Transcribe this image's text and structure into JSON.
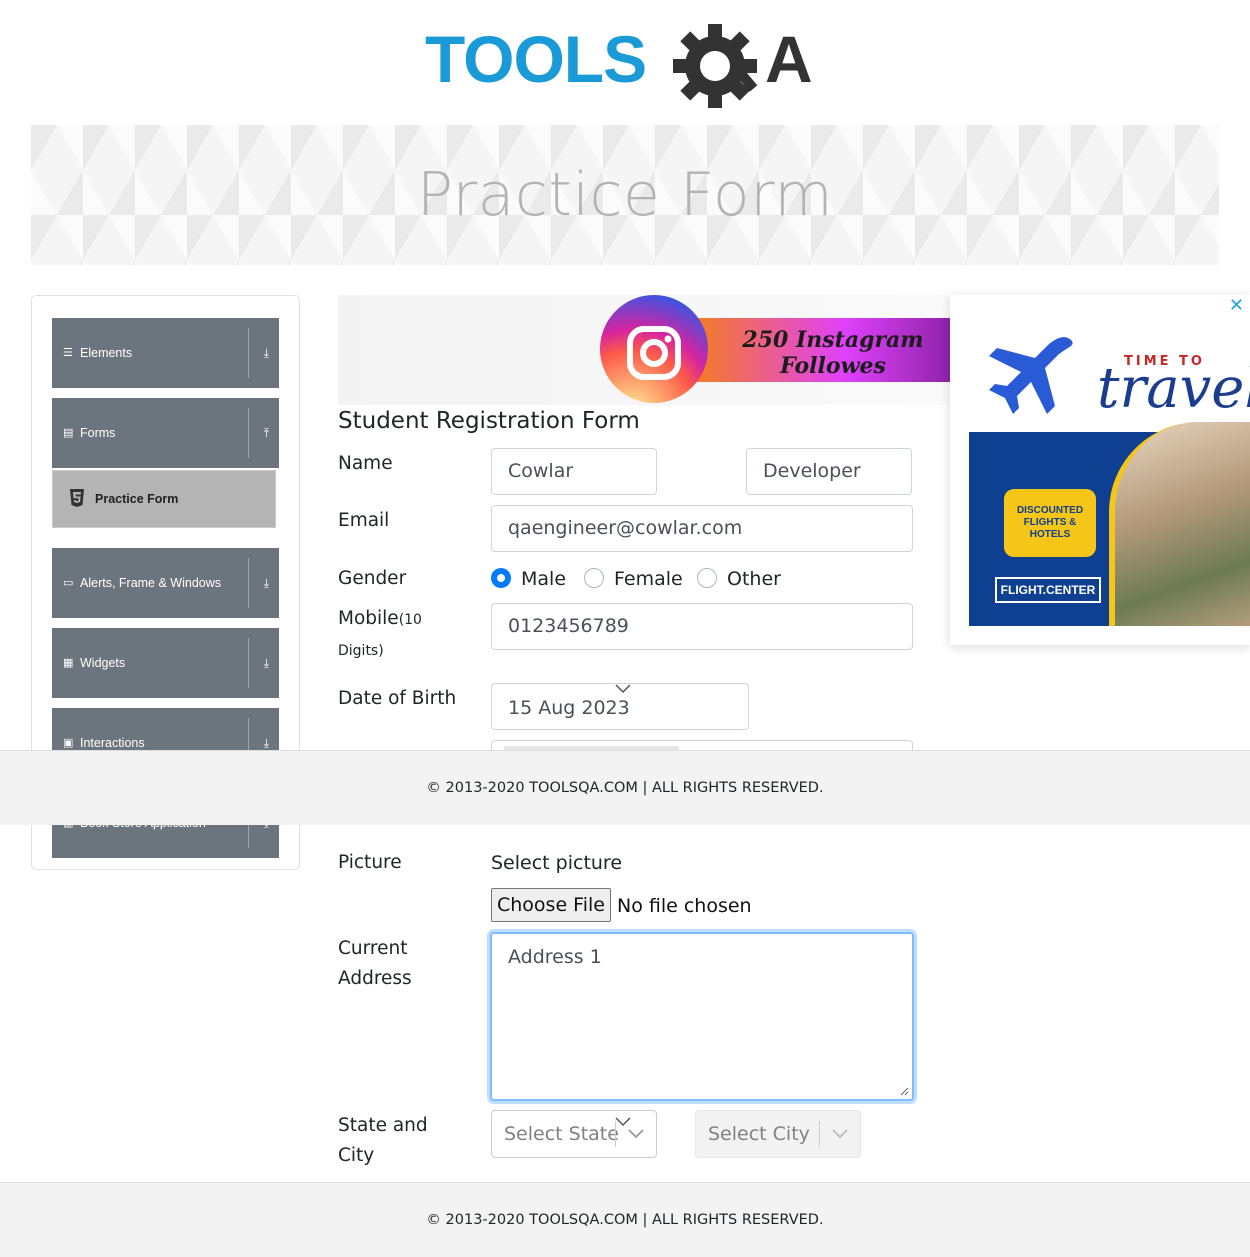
{
  "header": {
    "logo_text": "TOOLSQA",
    "logo_tools": "TOOLS",
    "logo_q": "Q",
    "logo_a": "A"
  },
  "banner": {
    "title": "Practice Form"
  },
  "sidebar": {
    "groups": [
      {
        "label": "Elements",
        "icon": "hamburger-icon",
        "arrow": "download-icon"
      },
      {
        "label": "Forms",
        "icon": "document-icon",
        "arrow": "upload-icon"
      },
      {
        "label": "Alerts, Frame & Windows",
        "icon": "window-icon",
        "arrow": "download-icon"
      },
      {
        "label": "Widgets",
        "icon": "grid-icon",
        "arrow": "download-icon"
      },
      {
        "label": "Interactions",
        "icon": "interactions-icon",
        "arrow": "download-icon"
      },
      {
        "label": "Book Store Application",
        "icon": "bar-chart-icon",
        "arrow": "download-icon"
      }
    ],
    "active_item": {
      "label": "Practice Form",
      "icon": "html5-icon"
    }
  },
  "ads": {
    "instagram": {
      "line1": "250 Instagram",
      "line2": "Followes"
    },
    "travel": {
      "time_to": "TIME TO",
      "travel": "travel",
      "bubble": "DISCOUNTED FLIGHTS & HOTELS",
      "brand": "FLIGHT.CENTER",
      "close": "✕"
    }
  },
  "form": {
    "title": "Student Registration Form",
    "name_label": "Name",
    "first_name": "Cowlar",
    "last_name": "Developer",
    "email_label": "Email",
    "email": "qaengineer@cowlar.com",
    "gender_label": "Gender",
    "gender_options": [
      {
        "label": "Male",
        "selected": true
      },
      {
        "label": "Female",
        "selected": false
      },
      {
        "label": "Other",
        "selected": false
      }
    ],
    "mobile_label": "Mobile",
    "mobile_hint_1": "(10",
    "mobile_hint_2": "Digits)",
    "mobile": "0123456789",
    "dob_label": "Date of Birth",
    "dob": "15 Aug 2023",
    "picture_label": "Picture",
    "select_picture": "Select picture",
    "choose_file": "Choose File",
    "no_file": "No file chosen",
    "address_label_1": "Current",
    "address_label_2": "Address",
    "address": "Address 1",
    "state_city_label_1": "State and",
    "state_city_label_2": "City",
    "state_placeholder": "Select State",
    "city_placeholder": "Select City"
  },
  "footer": {
    "text": "© 2013-2020 TOOLSQA.COM | ALL RIGHTS RESERVED."
  },
  "colors": {
    "logo_blue": "#1a9ad6",
    "logo_dark": "#333333",
    "sidebar_group": "#6c757d",
    "active_item": "#b4b4b4",
    "radio_selected": "#007bff",
    "focus_border": "#80bdff"
  }
}
